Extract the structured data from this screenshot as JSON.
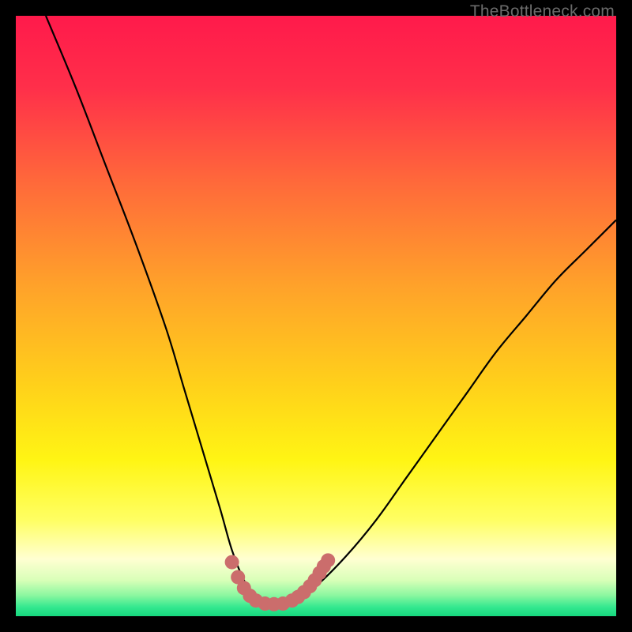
{
  "watermark": {
    "text": "TheBottleneck.com"
  },
  "colors": {
    "bg": "#000000",
    "gradient_stops": [
      {
        "offset": 0.0,
        "color": "#ff1a4b"
      },
      {
        "offset": 0.12,
        "color": "#ff2f4a"
      },
      {
        "offset": 0.28,
        "color": "#ff6a3a"
      },
      {
        "offset": 0.45,
        "color": "#ffa22a"
      },
      {
        "offset": 0.62,
        "color": "#ffd21a"
      },
      {
        "offset": 0.74,
        "color": "#fff514"
      },
      {
        "offset": 0.84,
        "color": "#ffff63"
      },
      {
        "offset": 0.905,
        "color": "#ffffd2"
      },
      {
        "offset": 0.94,
        "color": "#d9ffb8"
      },
      {
        "offset": 0.965,
        "color": "#8cf7a0"
      },
      {
        "offset": 0.985,
        "color": "#33e88f"
      },
      {
        "offset": 1.0,
        "color": "#16d77e"
      }
    ],
    "curve_stroke": "#000000",
    "marker_fill": "#cb6d6c"
  },
  "chart_data": {
    "type": "line",
    "title": "",
    "xlabel": "",
    "ylabel": "",
    "xlim": [
      0,
      100
    ],
    "ylim": [
      0,
      100
    ],
    "series": [
      {
        "name": "bottleneck-curve",
        "x": [
          5,
          10,
          15,
          20,
          25,
          28,
          31,
          34,
          36,
          38,
          40,
          42,
          44,
          47,
          50,
          55,
          60,
          65,
          70,
          75,
          80,
          85,
          90,
          95,
          100
        ],
        "y": [
          100,
          88,
          75,
          62,
          48,
          38,
          28,
          18,
          11,
          6,
          3,
          2,
          2,
          3,
          5,
          10,
          16,
          23,
          30,
          37,
          44,
          50,
          56,
          61,
          66
        ]
      }
    ],
    "markers": {
      "name": "dip-markers",
      "points": [
        {
          "x": 36.0,
          "y": 9.0
        },
        {
          "x": 37.0,
          "y": 6.5
        },
        {
          "x": 38.0,
          "y": 4.7
        },
        {
          "x": 39.0,
          "y": 3.4
        },
        {
          "x": 40.0,
          "y": 2.6
        },
        {
          "x": 41.5,
          "y": 2.1
        },
        {
          "x": 43.0,
          "y": 2.0
        },
        {
          "x": 44.5,
          "y": 2.1
        },
        {
          "x": 46.0,
          "y": 2.6
        },
        {
          "x": 47.0,
          "y": 3.2
        },
        {
          "x": 48.0,
          "y": 4.0
        },
        {
          "x": 49.0,
          "y": 5.0
        },
        {
          "x": 49.8,
          "y": 6.0
        },
        {
          "x": 50.6,
          "y": 7.2
        },
        {
          "x": 51.3,
          "y": 8.3
        },
        {
          "x": 52.0,
          "y": 9.3
        }
      ]
    }
  }
}
